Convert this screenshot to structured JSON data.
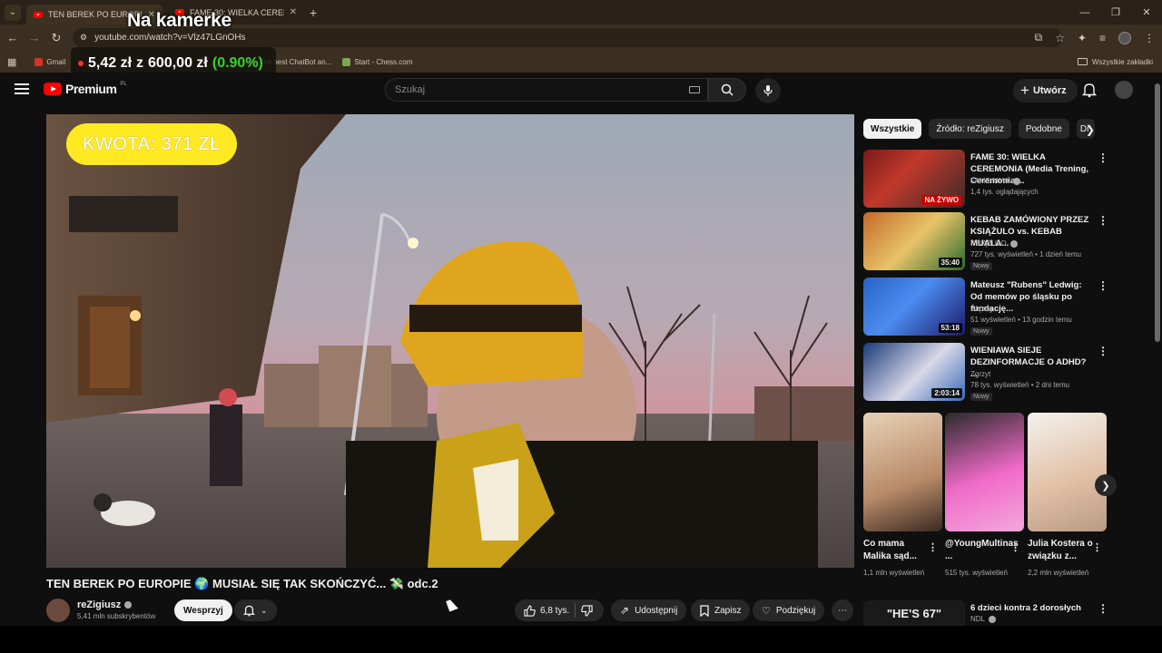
{
  "browser": {
    "tabs": [
      {
        "title": "TEN BEREK PO EUROPIE",
        "active": true
      },
      {
        "title": "FAME 30: WIELKA CEREMONIA",
        "active": false
      }
    ],
    "url": "youtube.com/watch?v=Vlz47LGnOHs",
    "bookmarks": [
      {
        "label": "Gmail",
        "color": "#d93025"
      },
      {
        "label": "The best ChatBot an...",
        "color": "#888888"
      },
      {
        "label": "Start - Chess.com",
        "color": "#7fa650"
      }
    ],
    "all_bookmarks_label": "Wszystkie zakładki"
  },
  "overlays": {
    "camera_title": "Na kamerke",
    "price_main": "5,42 zł",
    "price_from": "z",
    "price_goal": "600,00 zł",
    "price_pct": "(0.90%)"
  },
  "header": {
    "logo_text": "Premium",
    "logo_region": "PL",
    "search_placeholder": "Szukaj",
    "create_label": "Utwórz"
  },
  "video": {
    "kwota_label": "KWOTA: 371 ZŁ",
    "title": "TEN BEREK PO EUROPIE 🌍 MUSIAŁ SIĘ TAK SKOŃCZYĆ... 💸 odc.2",
    "channel": "reZigiusz",
    "subscribers": "5,41 mln subskrybentów",
    "support_label": "Wesprzyj",
    "likes": "6,8 tys.",
    "share_label": "Udostępnij",
    "save_label": "Zapisz",
    "thanks_label": "Podziękuj"
  },
  "sidebar": {
    "chips": [
      "Wszystkie",
      "Źródło: reZigiusz",
      "Podobne",
      "Di"
    ],
    "recommendations": [
      {
        "title": "FAME 30: WIELKA CEREMONIA (Media Trening, Ceremonia ...",
        "channel": "FAME MMA",
        "meta": "1,4 tys. oglądających",
        "badge": "",
        "duration": "",
        "live_label": "NA ŻYWO"
      },
      {
        "title": "KEBAB ZAMÓWIONY PRZEZ KSIĄŻULO vs. KEBAB MUALA...",
        "channel": "KSIĄŻULO",
        "meta": "727 tys. wyświetleń • 1 dzień temu",
        "badge": "Nowy",
        "duration": "35:40",
        "live_label": ""
      },
      {
        "title": "Mateusz \"Rubens\" Ledwig: Od memów po śląsku po fundację...",
        "channel": "Ślązag",
        "meta": "51 wyświetleń • 13 godzin temu",
        "badge": "Nowy",
        "duration": "53:18",
        "live_label": ""
      },
      {
        "title": "WIENIAWA SIEJE DEZINFORMACJE O ADHD? ...",
        "channel": "Zgrzyt",
        "meta": "78 tys. wyświetleń • 2 dni temu",
        "badge": "Nowy",
        "duration": "2:03:14",
        "live_label": ""
      }
    ],
    "shorts": [
      {
        "title": "Co mama Malika sąd...",
        "views": "1,1 mln wyświetleń"
      },
      {
        "title": "@YoungMultinas ...",
        "views": "515 tys. wyświetleń"
      },
      {
        "title": "Julia Kostera o związku z...",
        "views": "2,2 mln wyświetleń"
      }
    ],
    "last": {
      "title": "6 dzieci kontra 2 dorosłych",
      "channel": "NDL",
      "thumb_text": "\"HE'S 67\""
    }
  }
}
